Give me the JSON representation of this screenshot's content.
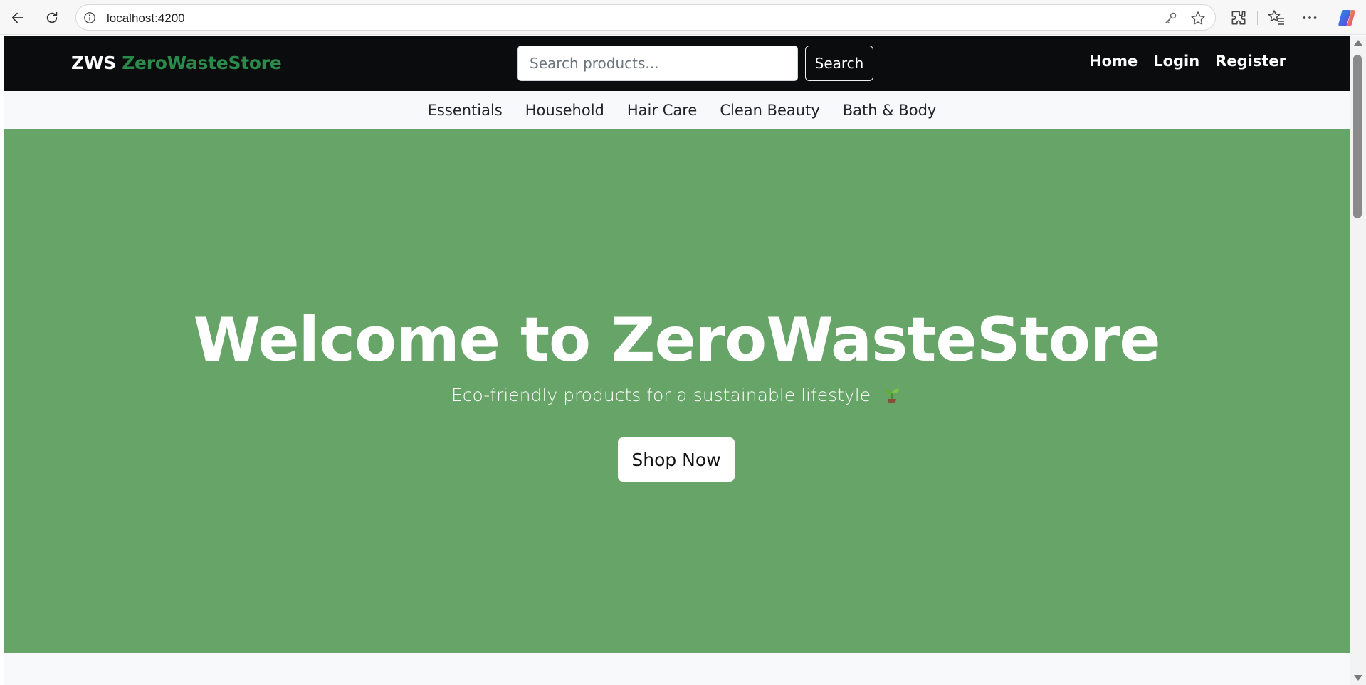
{
  "browser": {
    "url": "localhost:4200",
    "icons": [
      "back-arrow-icon",
      "reload-icon",
      "info-icon",
      "key-icon",
      "star-icon",
      "extensions-icon",
      "favorites-icon",
      "more-icon",
      "copilot-icon"
    ]
  },
  "navbar": {
    "brand_prefix": "ZWS",
    "brand_name": "ZeroWasteStore",
    "brand_color": "#2a8a4a",
    "background": "#0b0c0e",
    "search_placeholder": "Search products...",
    "search_button": "Search",
    "links": [
      "Home",
      "Login",
      "Register"
    ]
  },
  "categories": [
    "Essentials",
    "Household",
    "Hair Care",
    "Clean Beauty",
    "Bath & Body"
  ],
  "hero": {
    "background": "#67a467",
    "title": "Welcome to ZeroWasteStore",
    "subtitle": "Eco-friendly products for a sustainable lifestyle",
    "subtitle_icon": "sprout-icon",
    "cta": "Shop Now"
  }
}
